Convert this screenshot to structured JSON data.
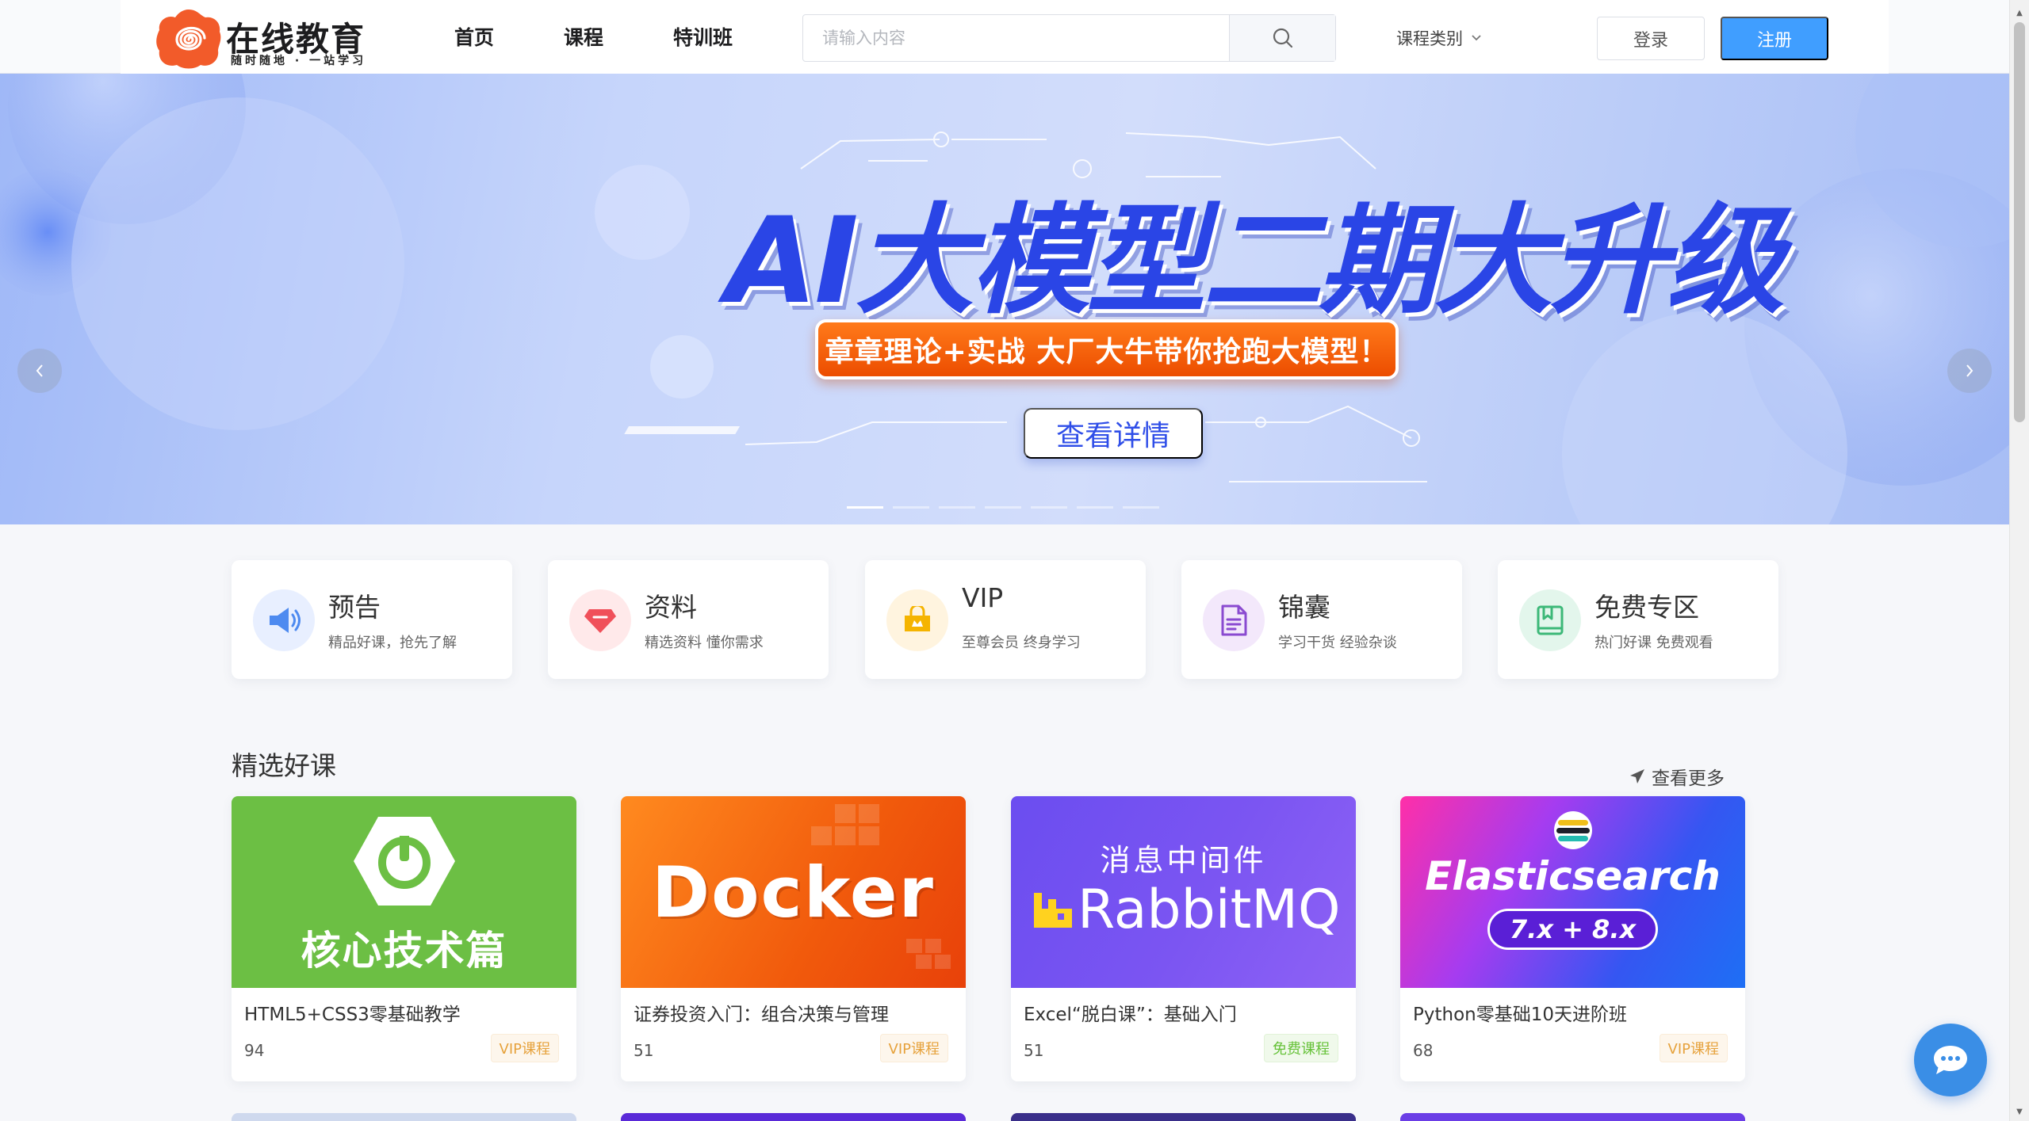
{
  "header": {
    "logo": {
      "title": "在线教育",
      "slogan": "随时随地 · 一站学习"
    },
    "nav": [
      {
        "label": "首页"
      },
      {
        "label": "课程"
      },
      {
        "label": "特训班"
      }
    ],
    "search": {
      "placeholder": "请输入内容",
      "value": ""
    },
    "category_dropdown": {
      "label": "课程类别"
    },
    "login_label": "登录",
    "register_label": "注册",
    "accent_color": "#409eff"
  },
  "banner": {
    "title": "AI大模型二期大升级",
    "subtitle": "章章理论+实战   大厂大牛带你抢跑大模型！",
    "cta_label": "查看详情",
    "prev_icon": "chevron-left-icon",
    "next_icon": "chevron-right-icon",
    "slide_count": 7,
    "active_slide": 1
  },
  "quick_entries": [
    {
      "title": "预告",
      "desc": "精品好课，抢先了解",
      "icon": "megaphone-icon",
      "color": "#4d8af0"
    },
    {
      "title": "资料",
      "desc": "精选资料 懂你需求",
      "icon": "gem-icon",
      "color": "#f0505a"
    },
    {
      "title": "VIP",
      "desc": "至尊会员 终身学习",
      "icon": "crown-bag-icon",
      "color": "#f5b400"
    },
    {
      "title": "锦囊",
      "desc": "学习干货 经验杂谈",
      "icon": "document-icon",
      "color": "#8a4ad0"
    },
    {
      "title": "免费专区",
      "desc": "热门好课 免费观看",
      "icon": "book-icon",
      "color": "#3cb878"
    }
  ],
  "featured": {
    "title": "精选好课",
    "see_more_label": "查看更多",
    "courses": [
      {
        "cover_text": "核心技术篇",
        "name": "HTML5+CSS3零基础教学",
        "count": "94",
        "badge": "VIP课程",
        "badge_type": "vip"
      },
      {
        "cover_text": "Docker",
        "name": "证券投资入门：组合决策与管理",
        "count": "51",
        "badge": "VIP课程",
        "badge_type": "vip"
      },
      {
        "cover_text": "消息中间件",
        "cover_text_2": "RabbitMQ",
        "name": "Excel“脱白课”：基础入门",
        "count": "51",
        "badge": "免费课程",
        "badge_type": "free"
      },
      {
        "cover_text": "Elasticsearch",
        "cover_text_2": "7.x + 8.x",
        "name": "Python零基础10天进阶班",
        "count": "68",
        "badge": "VIP课程",
        "badge_type": "vip"
      }
    ]
  },
  "chat": {
    "icon": "chat-bubble-icon"
  }
}
